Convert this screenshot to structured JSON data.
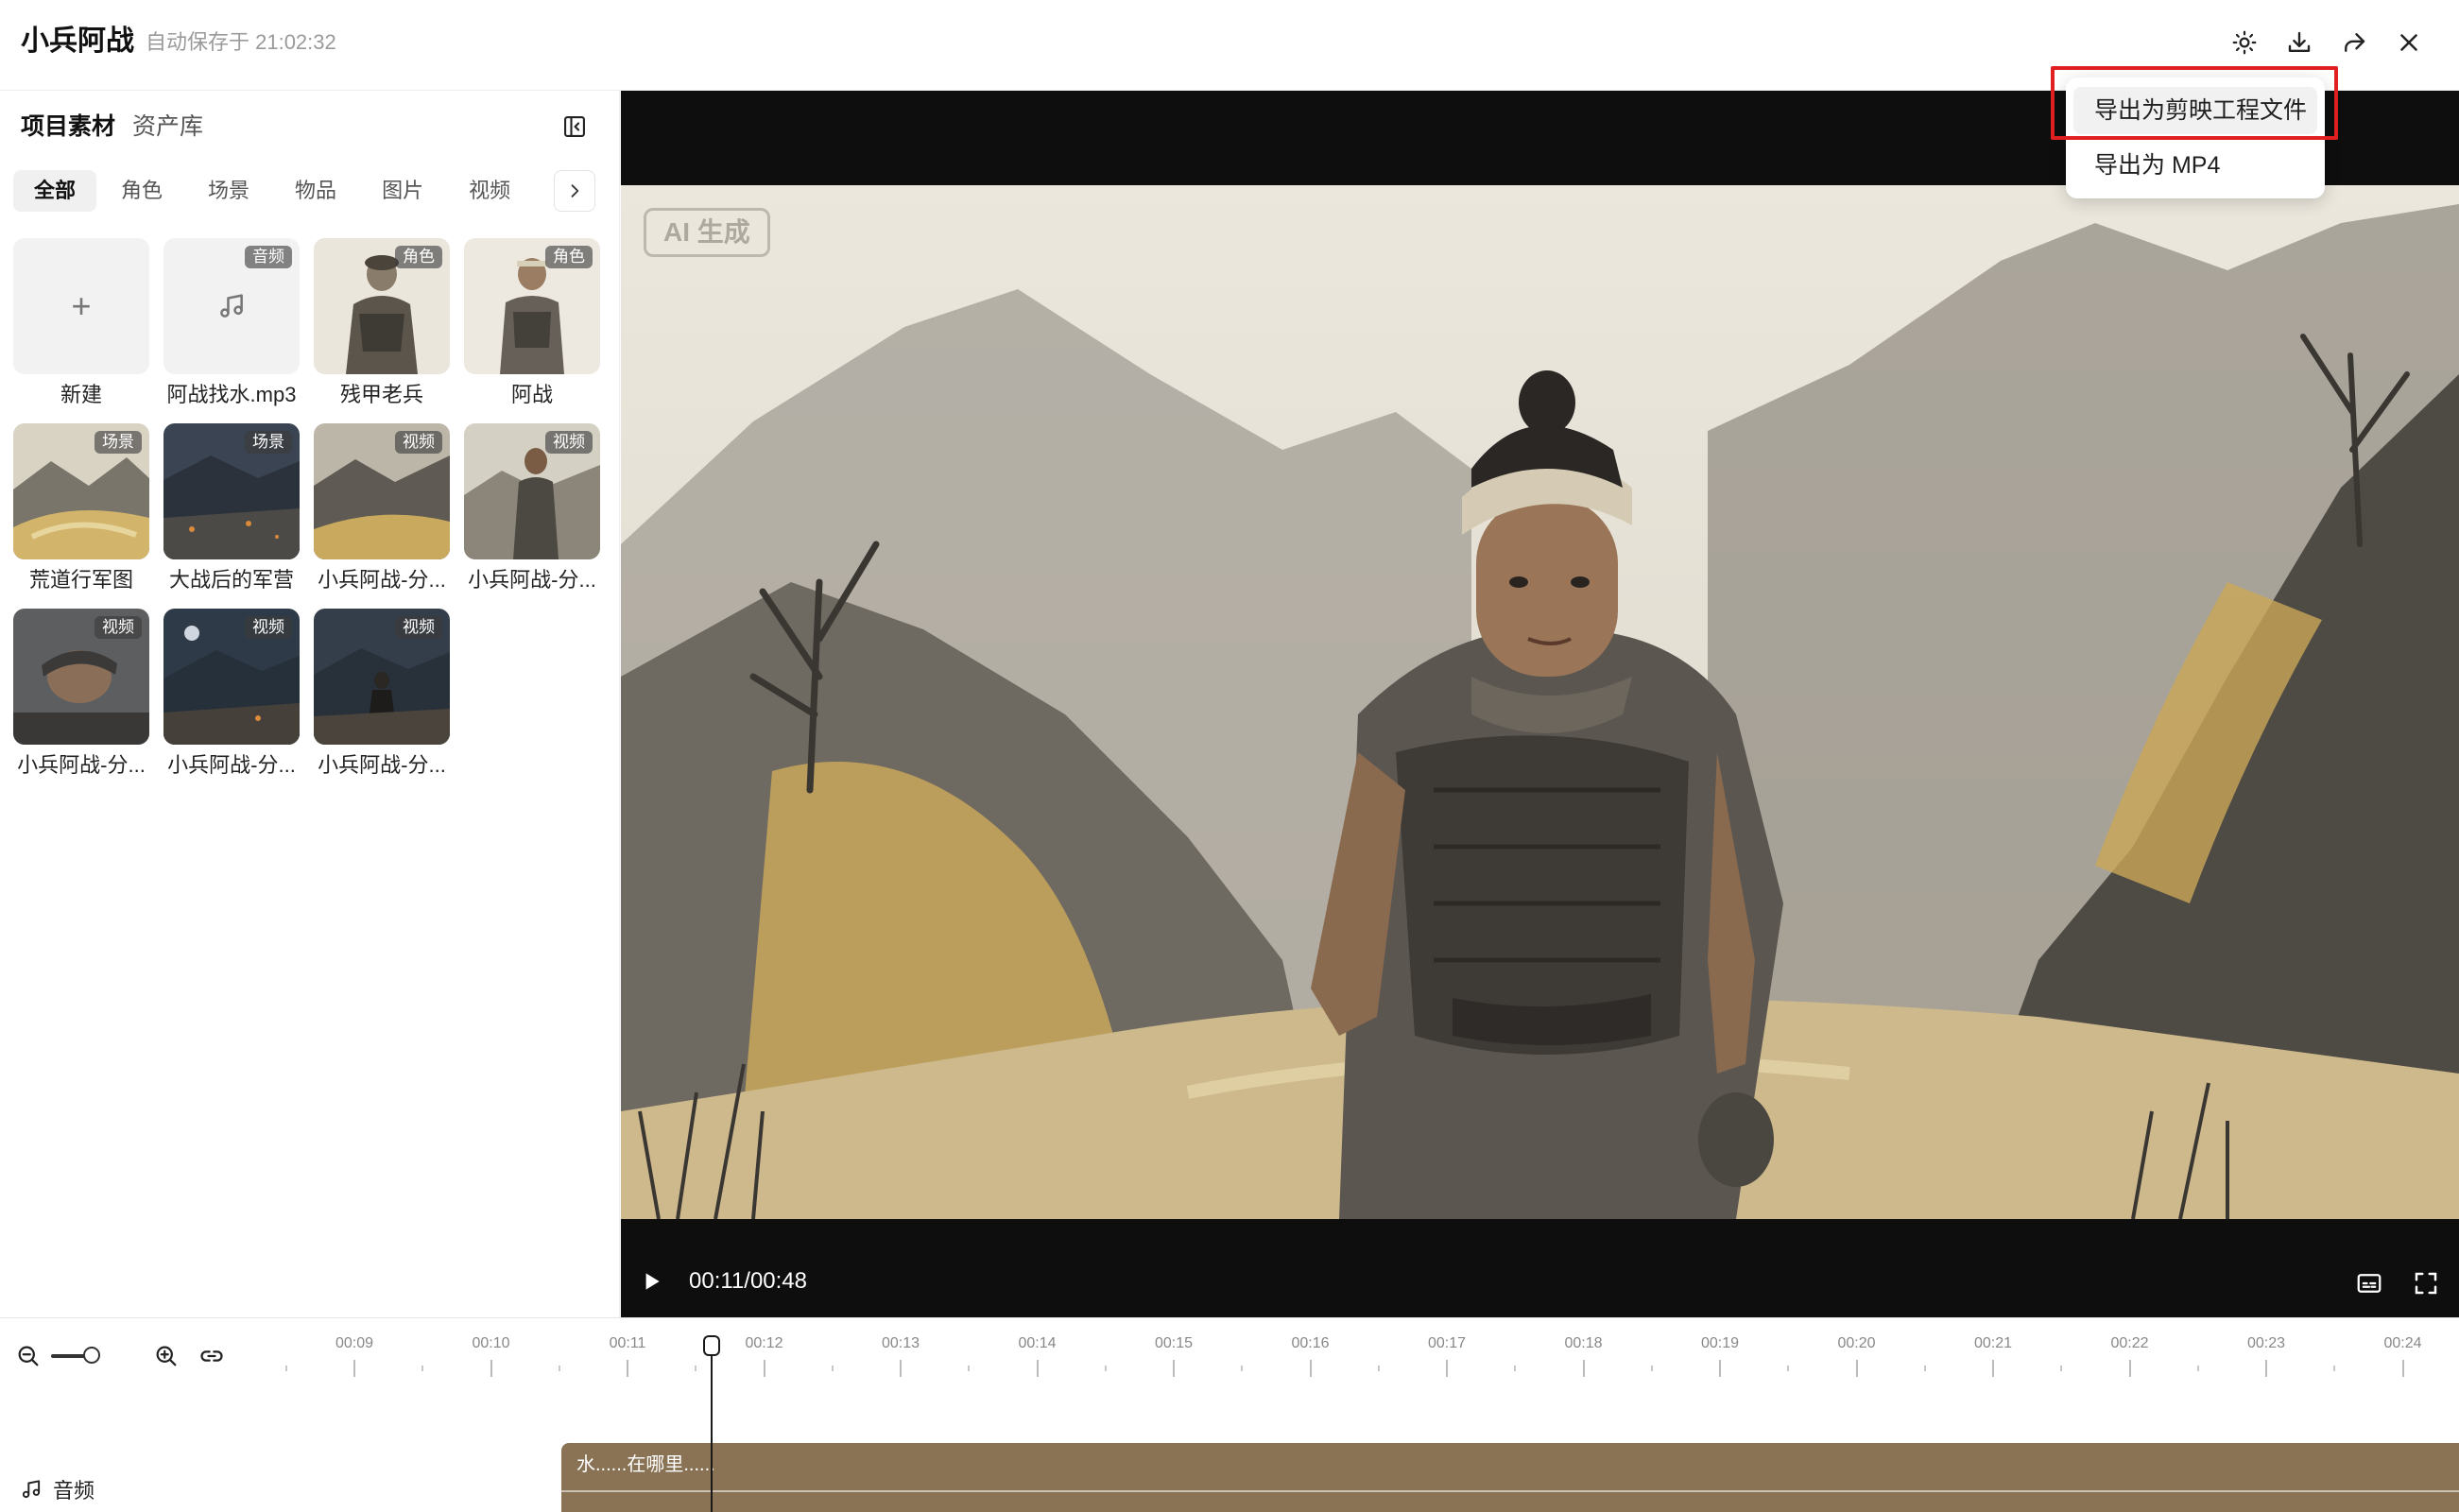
{
  "header": {
    "title": "小兵阿战",
    "autosave": "自动保存于 21:02:32",
    "icons": [
      "theme-icon",
      "download-icon",
      "share-icon",
      "close-icon"
    ]
  },
  "panel": {
    "tabs": [
      {
        "label": "项目素材",
        "active": true
      },
      {
        "label": "资产库",
        "active": false
      }
    ],
    "filters": [
      "全部",
      "角色",
      "场景",
      "物品",
      "图片",
      "视频"
    ],
    "active_filter": "全部",
    "assets": [
      {
        "label": "新建",
        "badge": "",
        "kind": "new"
      },
      {
        "label": "阿战找水.mp3",
        "badge": "音频",
        "kind": "audio"
      },
      {
        "label": "残甲老兵",
        "badge": "角色",
        "kind": "character"
      },
      {
        "label": "阿战",
        "badge": "角色",
        "kind": "character"
      },
      {
        "label": "荒道行军图",
        "badge": "场景",
        "kind": "scene"
      },
      {
        "label": "大战后的军营",
        "badge": "场景",
        "kind": "scene"
      },
      {
        "label": "小兵阿战-分...",
        "badge": "视频",
        "kind": "video"
      },
      {
        "label": "小兵阿战-分...",
        "badge": "视频",
        "kind": "video"
      },
      {
        "label": "小兵阿战-分...",
        "badge": "视频",
        "kind": "video"
      },
      {
        "label": "小兵阿战-分...",
        "badge": "视频",
        "kind": "video"
      },
      {
        "label": "小兵阿战-分...",
        "badge": "视频",
        "kind": "video"
      }
    ]
  },
  "player": {
    "ai_badge": "AI 生成",
    "timecode": "00:11/00:48"
  },
  "export_menu": {
    "items": [
      "导出为剪映工程文件",
      "导出为 MP4"
    ],
    "highlight_color": "#e02020"
  },
  "timeline": {
    "ticks": [
      "00:09",
      "00:10",
      "00:11",
      "00:12",
      "00:13",
      "00:14",
      "00:15",
      "00:16",
      "00:17",
      "00:18",
      "00:19",
      "00:20",
      "00:21",
      "00:22",
      "00:23",
      "00:24"
    ],
    "track_label": "音频",
    "clip_text": "水......在哪里......",
    "clip_color": "#8a7355"
  }
}
